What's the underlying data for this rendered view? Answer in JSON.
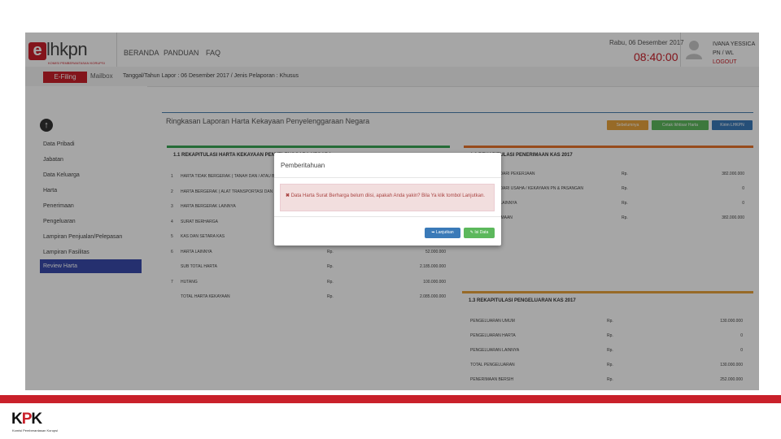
{
  "brand": {
    "logo_letter": "e",
    "logo_word": "lhkpn",
    "logo_tag": "KOMISI PEMBERANTASAN KORUPSI"
  },
  "nav": {
    "beranda": "BERANDA",
    "panduan": "PANDUAN",
    "faq": "FAQ"
  },
  "header": {
    "date": "Rabu, 06 Desember 2017",
    "clock": "08:40:00",
    "user_name": "IVANA YESSICA",
    "user_role": "PN / WL",
    "logout": "LOGOUT"
  },
  "subbar": {
    "efiling": "E-Filing",
    "mailbox": "Mailbox",
    "report_info": "Tanggal/Tahun Lapor : 06 Desember 2017 / Jenis Pelaporan : Khusus"
  },
  "sidebar": {
    "back_icon": "arrow-up-circle-icon",
    "items": [
      "Data Pribadi",
      "Jabatan",
      "Data Keluarga",
      "Harta",
      "Penerimaan",
      "Pengeluaran",
      "Lampiran Penjualan/Pelepasan",
      "Lampiran Fasilitas",
      "Review Harta"
    ]
  },
  "main": {
    "title": "Ringkasan Laporan Harta Kekayaan Penyelenggaraan Negara",
    "buttons": [
      "Sebelumnya",
      "Cetak Ikhtisar Harta",
      "Kirim LHKPN"
    ]
  },
  "harta_panel": {
    "title": "1.1 REKAPITULASI HARTA KEKAYAAN PENYELENGGARA NEGARA",
    "rows": [
      {
        "num": "1",
        "label": "HARTA TIDAK BERGERAK ( TANAH DAN / ATAU BANGUNAN )",
        "rp": "",
        "amount": ""
      },
      {
        "num": "2",
        "label": "HARTA BERGERAK ( ALAT TRANSPORTASI DAN MESIN )",
        "rp": "",
        "amount": ""
      },
      {
        "num": "3",
        "label": "HARTA BERGERAK LAINNYA",
        "rp": "",
        "amount": ""
      },
      {
        "num": "4",
        "label": "SURAT BERHARGA",
        "rp": "",
        "amount": ""
      },
      {
        "num": "5",
        "label": "KAS DAN SETARA KAS",
        "rp": "",
        "amount": ""
      },
      {
        "num": "6",
        "label": "HARTA LAINNYA",
        "rp": "Rp.",
        "amount": "52.000.000"
      },
      {
        "num": "",
        "label": "SUB TOTAL HARTA",
        "rp": "Rp.",
        "amount": "2.185.000.000"
      },
      {
        "num": "7",
        "label": "HUTANG",
        "rp": "Rp.",
        "amount": "100.000.000"
      },
      {
        "num": "",
        "label": "TOTAL HARTA KEKAYAAN",
        "rp": "Rp.",
        "amount": "2.085.000.000"
      }
    ]
  },
  "penerimaan_panel": {
    "title": "1.2 REKAPITULASI PENERIMAAN KAS 2017",
    "rows": [
      {
        "label": "PENERIMAAN DARI PEKERJAAN",
        "rp": "Rp.",
        "amount": "382.000.000"
      },
      {
        "label": "PENERIMAAN DARI USAHA / KEKAYAAN PN & PASANGAN",
        "rp": "Rp.",
        "amount": "0"
      },
      {
        "label": "PENERIMAAN LAINNYA",
        "rp": "Rp.",
        "amount": "0"
      },
      {
        "label": "TOTAL PENERIMAAN",
        "rp": "Rp.",
        "amount": "382.000.000"
      }
    ]
  },
  "pengeluaran_panel": {
    "title": "1.3 REKAPITULASI PENGELUARAN KAS 2017",
    "rows": [
      {
        "label": "PENGELUARAN UMUM",
        "rp": "Rp.",
        "amount": "130.000.000"
      },
      {
        "label": "PENGELUARAN HARTA",
        "rp": "Rp.",
        "amount": "0"
      },
      {
        "label": "PENGELUARAN LAINNYA",
        "rp": "Rp.",
        "amount": "0"
      },
      {
        "label": "TOTAL PENGELUARAN",
        "rp": "Rp.",
        "amount": "130.000.000"
      },
      {
        "label": "PENERIMAAN BERSIH",
        "rp": "Rp.",
        "amount": "252.000.000"
      }
    ]
  },
  "modal": {
    "title": "Pemberitahuan",
    "message": "Data Harta Surat Berharga belum diisi, apakah Anda yakin? Bila Ya klik tombol Lanjutkan.",
    "continue": "Lanjutkan",
    "fill": "Isi Data"
  },
  "footer": {
    "logo_k1": "K",
    "logo_p": "P",
    "logo_k2": "K",
    "org": "Komisi Pemberantasan Korupsi"
  },
  "colors": {
    "brand_red": "#c9202a",
    "modal_primary": "#3a7ab8",
    "modal_success": "#5cb85c",
    "sidebar_active": "#3a4bab"
  }
}
